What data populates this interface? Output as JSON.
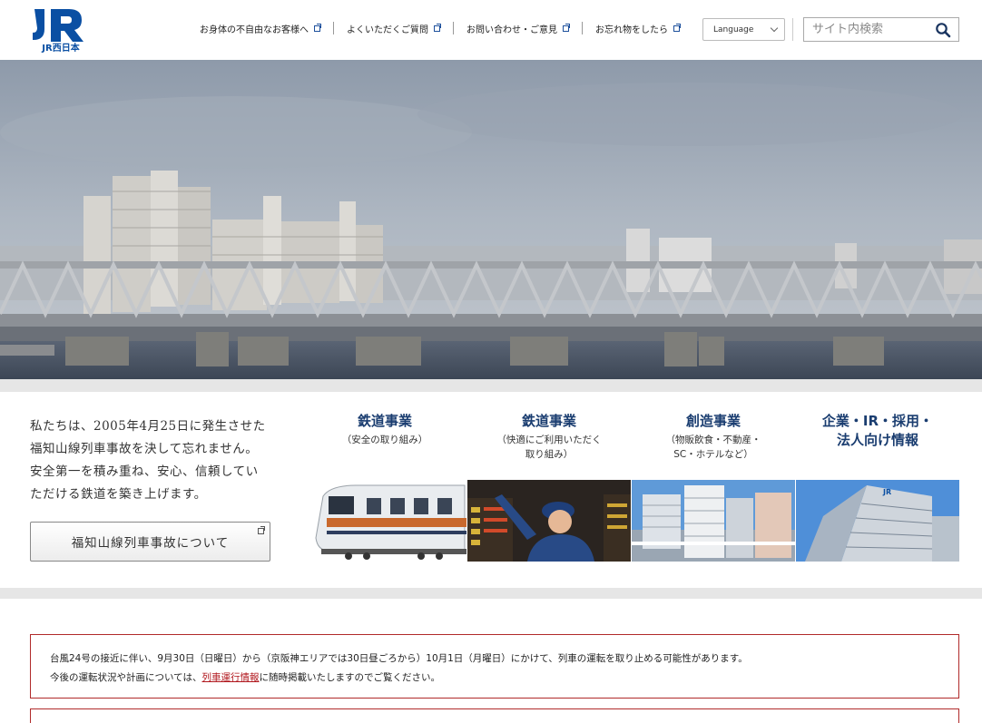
{
  "brand": {
    "logo_text": "JR",
    "logo_subtext": "JR西日本",
    "color": "#0a4fa3"
  },
  "header": {
    "util_links": [
      {
        "label": "お身体の不自由なお客様へ",
        "icon": "external-link-icon"
      },
      {
        "label": "よくいただくご質問",
        "icon": "external-link-icon"
      },
      {
        "label": "お問い合わせ・ご意見",
        "icon": "external-link-icon"
      },
      {
        "label": "お忘れ物をしたら",
        "icon": "external-link-icon"
      }
    ],
    "language": {
      "selected": "Language"
    },
    "search": {
      "placeholder": "サイト内検索",
      "icon": "search-icon"
    }
  },
  "memorial": {
    "lines": [
      "私たちは、2005年4月25日に発生させた",
      "福知山線列車事故を決して忘れません。",
      "安全第一を積み重ね、安心、信頼してい",
      "ただける鉄道を築き上げます。"
    ],
    "button_label": "福知山線列車事故について"
  },
  "business": [
    {
      "title": "鉄道事業",
      "sub": "（安全の取り組み）",
      "image": "train-photo"
    },
    {
      "title": "鉄道事業",
      "sub": "（快適にご利用いただく\n取り組み）",
      "image": "staff-photo"
    },
    {
      "title": "創造事業",
      "sub": "（物販飲食・不動産・\nSC・ホテルなど）",
      "image": "buildings-photo"
    },
    {
      "title": "企業・IR・採用・\n法人向け情報",
      "sub": "",
      "image": "office-photo"
    }
  ],
  "notice": {
    "line1": "台風24号の接近に伴い、9月30日（日曜日）から（京阪神エリアでは30日昼ごろから）10月1日（月曜日）にかけて、列車の運転を取り止める可能性があります。",
    "line2_before": "今後の運転状況や計画については、",
    "line2_link": "列車運行情報",
    "line2_after": "に随時掲載いたしますのでご覧ください。",
    "border_color": "#b02a2a"
  }
}
